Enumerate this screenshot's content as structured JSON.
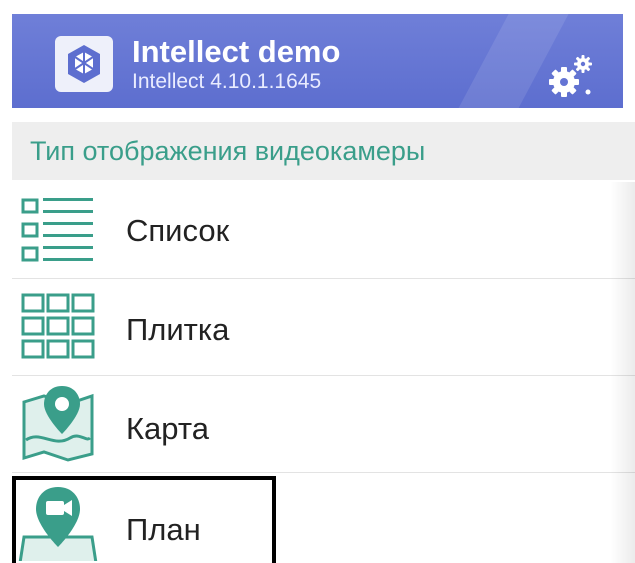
{
  "header": {
    "title": "Intellect demo",
    "subtitle": "Intellect 4.10.1.1645",
    "logo_icon": "intellect-logo-icon",
    "settings_icon": "gear-settings-icon"
  },
  "section": {
    "title": "Тип отображения видеокамеры"
  },
  "menu": {
    "items": [
      {
        "label": "Список",
        "icon": "list-view-icon"
      },
      {
        "label": "Плитка",
        "icon": "tile-grid-icon"
      },
      {
        "label": "Карта",
        "icon": "map-pin-icon"
      },
      {
        "label": "План",
        "icon": "plan-camera-pin-icon"
      }
    ]
  },
  "colors": {
    "header_bg": "#6474d4",
    "accent": "#3a9e8a",
    "section_bg": "#eeeeee",
    "text": "#222222"
  }
}
